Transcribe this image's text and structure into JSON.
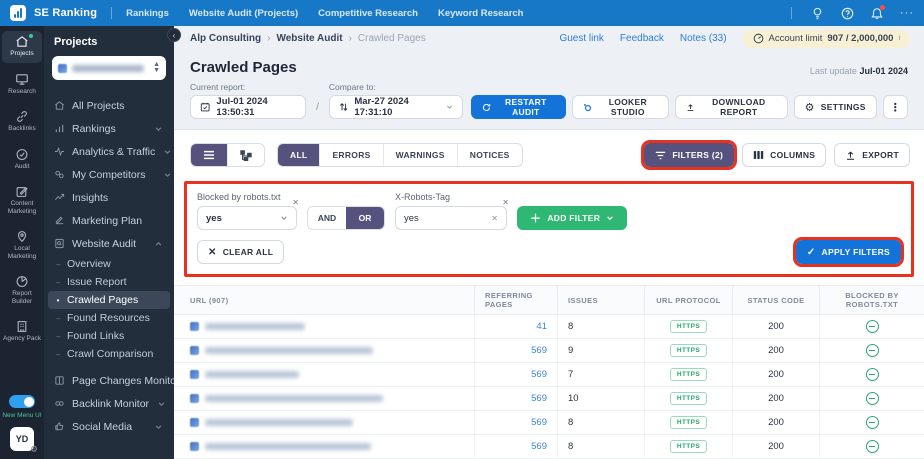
{
  "topnav": {
    "brand": "SE Ranking",
    "items": [
      "Rankings",
      "Website Audit (Projects)",
      "Competitive Research",
      "Keyword Research"
    ],
    "more": "···"
  },
  "rail": {
    "items": [
      {
        "label": "Projects"
      },
      {
        "label": "Research"
      },
      {
        "label": "Backlinks"
      },
      {
        "label": "Audit"
      },
      {
        "label": "Content Marketing"
      },
      {
        "label": "Local Marketing"
      },
      {
        "label": "Report Builder"
      },
      {
        "label": "Agency Pack"
      }
    ],
    "toggle_label": "New Menu UI",
    "avatar": "YD",
    "gear": "⚙"
  },
  "sidebar": {
    "title": "Projects",
    "items": [
      {
        "label": "All Projects"
      },
      {
        "label": "Rankings"
      },
      {
        "label": "Analytics & Traffic"
      },
      {
        "label": "My Competitors"
      },
      {
        "label": "Insights"
      },
      {
        "label": "Marketing Plan"
      },
      {
        "label": "Website Audit"
      },
      {
        "label": "Page Changes Monitor"
      },
      {
        "label": "Backlink Monitor"
      },
      {
        "label": "Social Media"
      }
    ],
    "audit_children": [
      {
        "label": "Overview"
      },
      {
        "label": "Issue Report"
      },
      {
        "label": "Crawled Pages",
        "active": true
      },
      {
        "label": "Found Resources"
      },
      {
        "label": "Found Links"
      },
      {
        "label": "Crawl Comparison"
      }
    ]
  },
  "header": {
    "breadcrumb": [
      "Alp Consulting",
      "Website Audit",
      "Crawled Pages"
    ],
    "links": [
      "Guest link",
      "Feedback",
      "Notes (33)"
    ],
    "account_limit_label": "Account limit",
    "account_limit_value": "907 / 2,000,000",
    "info_sup": "i"
  },
  "page": {
    "title": "Crawled Pages",
    "last_update_label": "Last update",
    "last_update_value": "Jul-01 2024",
    "current_report_label": "Current report:",
    "current_report_value": "Jul-01 2024 13:50:31",
    "compare_label": "Compare to:",
    "compare_value": "Mar-27 2024 17:31:10",
    "slash": "/",
    "buttons": {
      "restart": "RESTART AUDIT",
      "looker": "LOOKER STUDIO",
      "download": "DOWNLOAD REPORT",
      "settings": "SETTINGS"
    }
  },
  "toolbar": {
    "tabs": [
      "ALL",
      "ERRORS",
      "WARNINGS",
      "NOTICES"
    ],
    "filters": "FILTERS (2)",
    "columns": "COLUMNS",
    "export": "EXPORT"
  },
  "filters": {
    "filter1_label": "Blocked by robots.txt",
    "filter1_value": "yes",
    "op_and": "AND",
    "op_or": "OR",
    "filter2_label": "X-Robots-Tag",
    "filter2_value": "yes",
    "add_filter": "ADD FILTER",
    "clear_all": "CLEAR ALL",
    "apply": "APPLY FILTERS"
  },
  "table": {
    "columns": [
      "URL  (907)",
      "REFERRING PAGES",
      "ISSUES",
      "URL PROTOCOL",
      "STATUS CODE",
      "BLOCKED BY ROBOTS.TXT"
    ],
    "rows": [
      {
        "referring": "41",
        "issues": "8",
        "protocol": "HTTPS",
        "status": "200"
      },
      {
        "referring": "569",
        "issues": "9",
        "protocol": "HTTPS",
        "status": "200"
      },
      {
        "referring": "569",
        "issues": "7",
        "protocol": "HTTPS",
        "status": "200"
      },
      {
        "referring": "569",
        "issues": "10",
        "protocol": "HTTPS",
        "status": "200"
      },
      {
        "referring": "569",
        "issues": "8",
        "protocol": "HTTPS",
        "status": "200"
      },
      {
        "referring": "569",
        "issues": "8",
        "protocol": "HTTPS",
        "status": "200"
      }
    ]
  },
  "colors": {
    "topbar": "#1878c8",
    "primary_blue": "#1373d9",
    "purple": "#56527e",
    "green_button": "#2eb873",
    "ok_green": "#2aa76c",
    "annotation_red": "#e8311f",
    "sidebar_dark": "#232e3d",
    "rail_dark": "#1b2430"
  }
}
